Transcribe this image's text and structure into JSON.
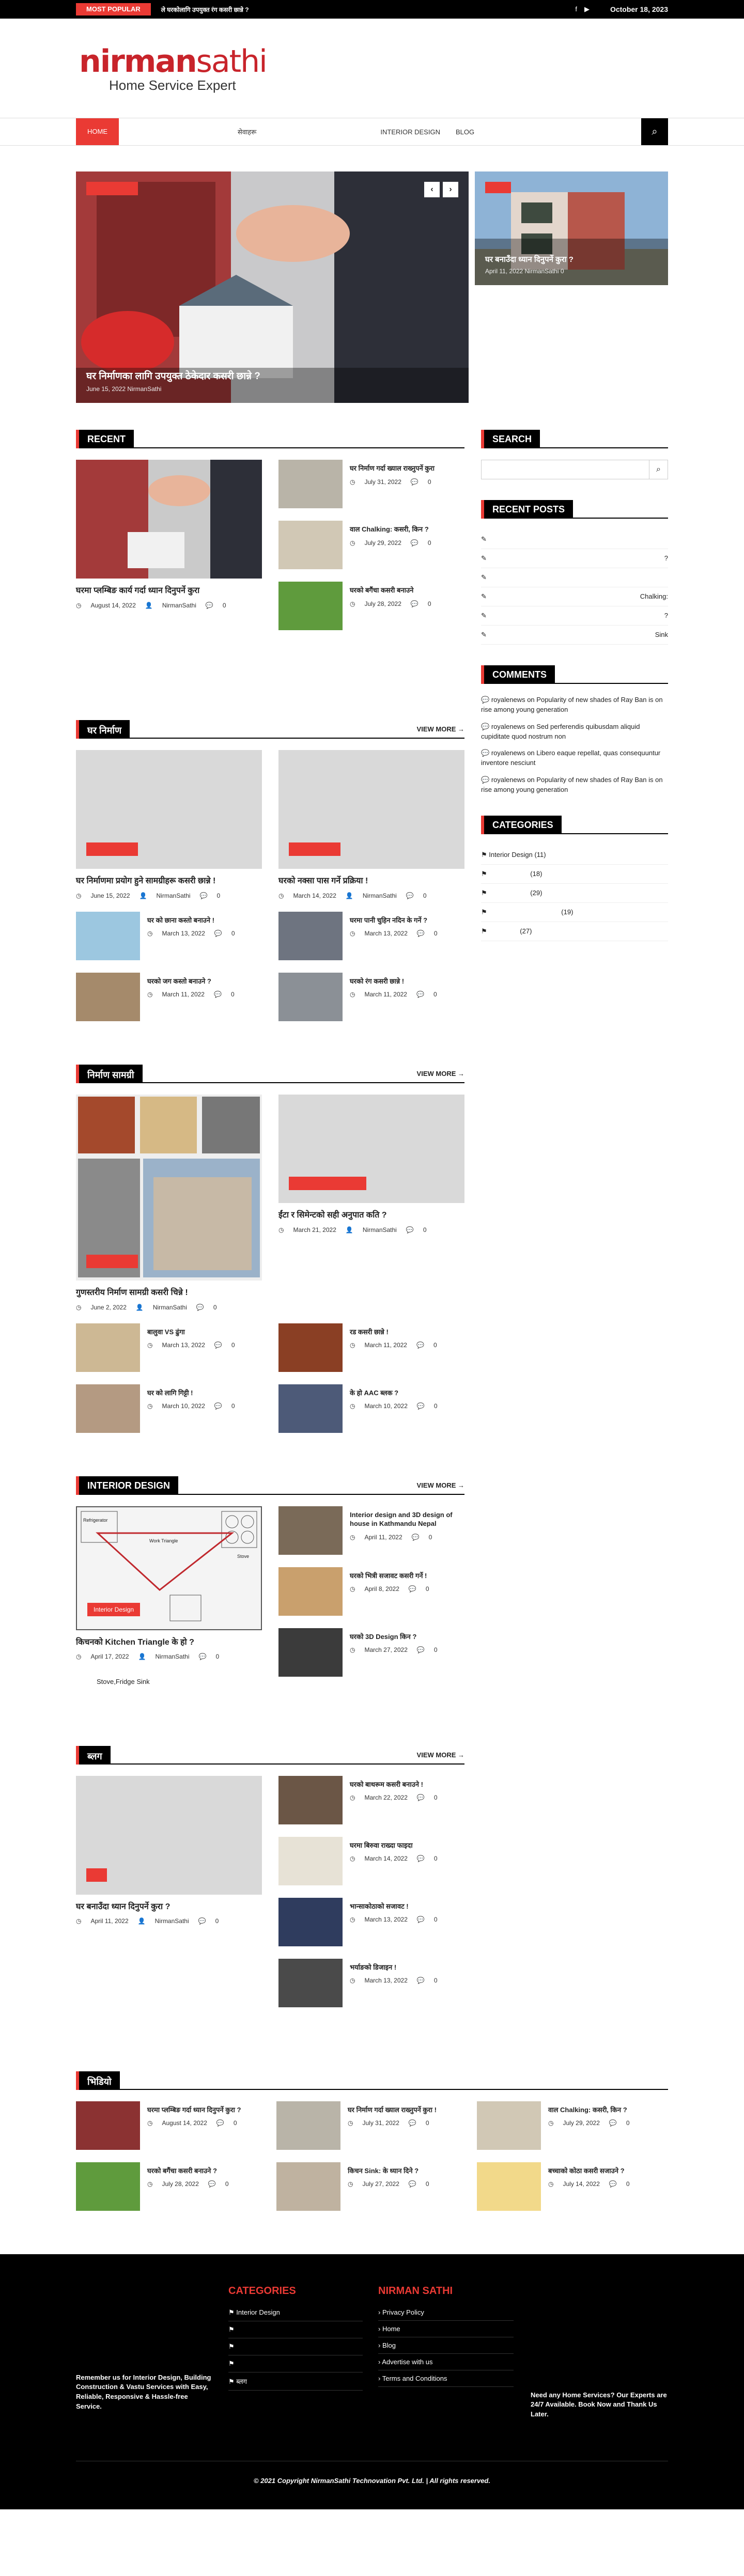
{
  "topbar": {
    "popular": "MOST POPULAR",
    "ticker": "ले घरकोलागि उपयुक्त रंग कसरी छान्ने ?",
    "date": "October 18, 2023"
  },
  "logo": {
    "brand_a": "nirman",
    "brand_b": "sathi",
    "tagline": "Home Service Expert"
  },
  "nav": {
    "home": "HOME",
    "item2": "सेवाहरू",
    "item3": "INTERIOR DESIGN",
    "item4": "BLOG"
  },
  "hero": {
    "main_title": "घर निर्माणका लागि उपयुक्त ठेकेदार कसरी छान्ने ?",
    "main_meta": "June 15, 2022  NirmanSathi",
    "side_title": "घर बनाउँदा ध्यान दिनुपर्ने कुरा ?",
    "side_meta": "April 11, 2022  NirmanSathi  0"
  },
  "recent": {
    "title": "RECENT",
    "main_title": "घरमा प्लम्बिङ कार्य गर्दा ध्यान दिनुपर्ने कुरा",
    "main_date": "August 14, 2022",
    "author": "NirmanSathi",
    "count": "0",
    "items": [
      {
        "title": "घर निर्माण गर्दा ख्याल राख्नुपर्ने कुरा",
        "date": "July 31, 2022",
        "count": "0"
      },
      {
        "title": "वाल Chalking: कसरी, किन ?",
        "date": "July 29, 2022",
        "count": "0"
      },
      {
        "title": "घरको बगैंचा कसरी बनाउने",
        "date": "July 28, 2022",
        "count": "0"
      }
    ]
  },
  "sec2": {
    "title": "घर निर्माण",
    "more": "VIEW MORE →",
    "a_title": "घर निर्माणमा प्रयोग हुने सामग्रीहरू कसरी छान्ने !",
    "a_date": "June 15, 2022",
    "a_author": "NirmanSathi",
    "a_count": "0",
    "b_title": "घरको नक्सा पास गर्ने प्रक्रिया !",
    "b_date": "March 14, 2022",
    "b_author": "NirmanSathi",
    "b_count": "0",
    "items": [
      {
        "title": "घर को छाना कस्तो बनाउने !",
        "date": "March 13, 2022",
        "count": "0"
      },
      {
        "title": "घरमा पानी चुहिन नदिन के गर्ने ?",
        "date": "March 13, 2022",
        "count": "0"
      },
      {
        "title": "घरको जग कस्तो बनाउने ?",
        "date": "March 11, 2022",
        "count": "0"
      },
      {
        "title": "घरको रंग कसरी छान्ने !",
        "date": "March 11, 2022",
        "count": "0"
      }
    ]
  },
  "sec3": {
    "title": "निर्माण सामग्री",
    "more": "VIEW MORE →",
    "a_title": "गुणस्तरीय निर्माण सामग्री कसरी चिन्ने !",
    "a_date": "June 2, 2022",
    "a_author": "NirmanSathi",
    "a_count": "0",
    "b_title": "ईंटा र सिमेन्टको सही अनुपात कति ?",
    "b_date": "March 21, 2022",
    "b_author": "NirmanSathi",
    "b_count": "0",
    "items": [
      {
        "title": "बालुवा VS ढुंगा",
        "date": "March 13, 2022",
        "count": "0"
      },
      {
        "title": "रड कसरी छान्ने !",
        "date": "March 11, 2022",
        "count": "0"
      },
      {
        "title": "घर को लागि गिट्टी !",
        "date": "March 10, 2022",
        "count": "0"
      },
      {
        "title": "के हो AAC ब्लक ?",
        "date": "March 10, 2022",
        "count": "0"
      }
    ]
  },
  "sec4": {
    "title": "INTERIOR DESIGN",
    "more": "VIEW MORE →",
    "badge": "Interior Design",
    "a_title": "किचनको Kitchen Triangle के हो ?",
    "a_date": "April 17, 2022",
    "a_author": "NirmanSathi",
    "a_count": "0",
    "a_excerpt": "Stove,Fridge  Sink",
    "diagram": {
      "fridge": "Refrigerator",
      "stove": "Stove",
      "work": "Work Triangle"
    },
    "items": [
      {
        "title": "Interior design and 3D design of house in Kathmandu Nepal",
        "date": "April 11, 2022",
        "count": "0"
      },
      {
        "title": "घरको भित्री सजावट कसरी गर्ने !",
        "date": "April 8, 2022",
        "count": "0"
      },
      {
        "title": "घरको 3D Design किन ?",
        "date": "March 27, 2022",
        "count": "0"
      }
    ]
  },
  "sec5": {
    "title": "ब्लग",
    "more": "VIEW MORE →",
    "a_title": "घर बनाउँदा ध्यान दिनुपर्ने कुरा ?",
    "a_date": "April 11, 2022",
    "a_author": "NirmanSathi",
    "a_count": "0",
    "items": [
      {
        "title": "घरको बाथरूम कसरी बनाउने !",
        "date": "March 22, 2022",
        "count": "0"
      },
      {
        "title": "घरमा बिरुवा राख्दा फाइदा",
        "date": "March 14, 2022",
        "count": "0"
      },
      {
        "title": "भान्साकोठाको सजावट !",
        "date": "March 13, 2022",
        "count": "0"
      },
      {
        "title": "भर्याङको डिजाइन !",
        "date": "March 13, 2022",
        "count": "0"
      }
    ]
  },
  "sec6": {
    "title": "भिडियो",
    "items": [
      {
        "title": "घरमा प्लम्बिङ गर्दा ध्यान दिनुपर्ने कुरा ?",
        "date": "August 14, 2022",
        "count": "0"
      },
      {
        "title": "घर निर्माण गर्दा ख्याल राख्नुपर्ने कुरा !",
        "date": "July 31, 2022",
        "count": "0"
      },
      {
        "title": "वाल Chalking: कसरी, किन ?",
        "date": "July 29, 2022",
        "count": "0"
      },
      {
        "title": "घरको बगैंचा कसरी बनाउने ?",
        "date": "July 28, 2022",
        "count": "0"
      },
      {
        "title": "किचन Sink: के ध्यान दिने ?",
        "date": "July 27, 2022",
        "count": "0"
      },
      {
        "title": "बच्चाको कोठा कसरी सजाउने ?",
        "date": "July 14, 2022",
        "count": "0"
      }
    ]
  },
  "sidebar": {
    "search_title": "SEARCH",
    "search_placeholder": "",
    "recent_title": "RECENT POSTS",
    "recent": [
      "",
      "?",
      "",
      "Chalking:",
      "?",
      "Sink"
    ],
    "comments_title": "COMMENTS",
    "comments": [
      {
        "user": "royalenews",
        "on": "on",
        "text": "Popularity of new shades of Ray Ban is on rise among young generation"
      },
      {
        "user": "royalenews",
        "on": "on",
        "text": "Sed perferendis quibusdam aliquid cupiditate quod nostrum non"
      },
      {
        "user": "royalenews",
        "on": "on",
        "text": "Libero eaque repellat, quas consequuntur inventore nesciunt"
      },
      {
        "user": "royalenews",
        "on": "on",
        "text": "Popularity of new shades of Ray Ban is on rise among young generation"
      }
    ],
    "categories_title": "CATEGORIES",
    "categories": [
      {
        "name": "Interior Design",
        "count": "(11)"
      },
      {
        "name": "",
        "count": "(18)"
      },
      {
        "name": "",
        "count": "(29)"
      },
      {
        "name": "",
        "count": "(19)"
      },
      {
        "name": "",
        "count": "(27)"
      }
    ]
  },
  "footer": {
    "about": "Remember us for Interior Design, Building Construction & Vastu Services with Easy, Reliable, Responsive & Hassle-free Service.",
    "cat_title": "CATEGORIES",
    "cats": [
      "Interior Design",
      "",
      "",
      "",
      "ब्लग"
    ],
    "ns_title": "NIRMAN SATHI",
    "links": [
      "Privacy Policy",
      "Home",
      "Blog",
      "Advertise with us",
      "Terms and Conditions"
    ],
    "help": "Need any Home Services? Our Experts are 24/7 Available. Book Now and Thank Us Later.",
    "copy": "© 2021 Copyright NirmanSathi Technovation Pvt. Ltd. | All rights reserved."
  }
}
